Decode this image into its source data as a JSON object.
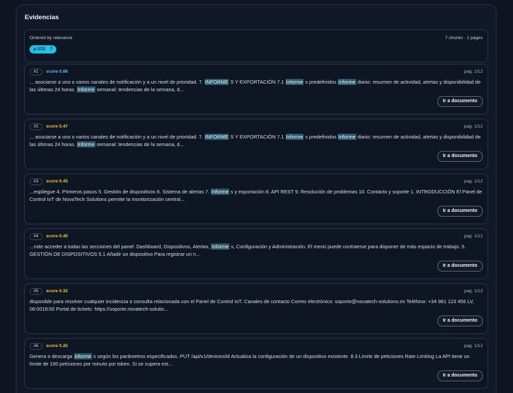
{
  "panel": {
    "title": "Evidencias"
  },
  "summary": {
    "sort_label": "Ordered by relevance",
    "counts": "7 chunks · 1 pages",
    "page_chip": {
      "label": "p.1/12",
      "count": "7"
    }
  },
  "button_label": "Ir a documento",
  "colors": {
    "accent": "#22c2e8",
    "highlight": "#2c5a6a",
    "score_blue": "#5fb3ff",
    "score_yellow": "#f1c232"
  },
  "results": [
    {
      "rank": "#1",
      "score": "score 0.86",
      "score_color": "blue",
      "page": "pag. 1/12",
      "parts": [
        {
          "t": "... asociarse a uno o varios canales de notificación y a un nivel de prioridad. 7. "
        },
        {
          "t": "INFORME",
          "hl": true
        },
        {
          "t": " S Y EXPORTACIÓN 7.1 "
        },
        {
          "t": "Informe",
          "hl": true
        },
        {
          "t": " s predefinidos "
        },
        {
          "t": "Informe",
          "hl": true
        },
        {
          "t": " diario: resumen de actividad, alertas y disponibilidad de las últimas 24 horas. "
        },
        {
          "t": "Informe",
          "hl": true
        },
        {
          "t": " semanal: tendencias de la semana, d..."
        }
      ]
    },
    {
      "rank": "#2",
      "score": "score 0.47",
      "score_color": "yellow",
      "page": "pag. 1/12",
      "parts": [
        {
          "t": "... asociarse a uno o varios canales de notificación y a un nivel de prioridad. 7. "
        },
        {
          "t": "INFORME",
          "hl": true
        },
        {
          "t": " S Y EXPORTACIÓN 7.1 "
        },
        {
          "t": "Informe",
          "hl": true
        },
        {
          "t": " s predefinidos "
        },
        {
          "t": "Informe",
          "hl": true
        },
        {
          "t": " diario: resumen de actividad, alertas y disponibilidad de las últimas 24 horas. "
        },
        {
          "t": "Informe",
          "hl": true
        },
        {
          "t": " semanal: tendencias de la semana, d..."
        }
      ]
    },
    {
      "rank": "#3",
      "score": "score 0.45",
      "score_color": "yellow",
      "page": "pag. 1/12",
      "parts": [
        {
          "t": "...espliegue 4. Primeros pasos 5. Gestión de dispositivos 6. Sistema de alertas 7. "
        },
        {
          "t": "Informe",
          "hl": true
        },
        {
          "t": " s y exportación 8. API REST 9. Resolución de problemas 10. Contacto y soporte 1. INTRODUCCIÓN El Panel de Control IoT de NovaTech Solutions permite la monitorización central..."
        }
      ]
    },
    {
      "rank": "#4",
      "score": "score 0.40",
      "score_color": "yellow",
      "page": "pag. 1/12",
      "parts": [
        {
          "t": "...mite acceder a todas las secciones del panel: Dashboard, Dispositivos, Alertas, "
        },
        {
          "t": "Informe",
          "hl": true
        },
        {
          "t": " s, Configuración y Administración. El menú puede contraerse para disponer de más espacio de trabajo. 5. GESTIÓN DE DISPOSITIVOS 5.1 Añadir un dispositivo Para registrar un n..."
        }
      ]
    },
    {
      "rank": "#5",
      "score": "score 0.32",
      "score_color": "yellow",
      "page": "pag. 1/12",
      "parts": [
        {
          "t": "disponible para resolver cualquier incidencia o consulta relacionada con el Panel de Control IoT. Canales de contacto Correo electrónico: soporte@novatech-solutions.es Teléfono: +34 981 123 456 LV, 08:0018:00 Portal de tickets: https://soporte.novatech-solutio..."
        }
      ]
    },
    {
      "rank": "#6",
      "score": "score 0.25",
      "score_color": "yellow",
      "page": "pag. 1/12",
      "parts": [
        {
          "t": "Genera o descarga "
        },
        {
          "t": "informe",
          "hl": true
        },
        {
          "t": " s según los parámetros especificados. PUT /api/v1/devices/id Actualiza la configuración de un dispositivo existente. 8.3 Límite de peticiones Rate Limiting La API tiene un límite de 100 peticiones por minuto por token. Si se supera est..."
        }
      ]
    }
  ]
}
